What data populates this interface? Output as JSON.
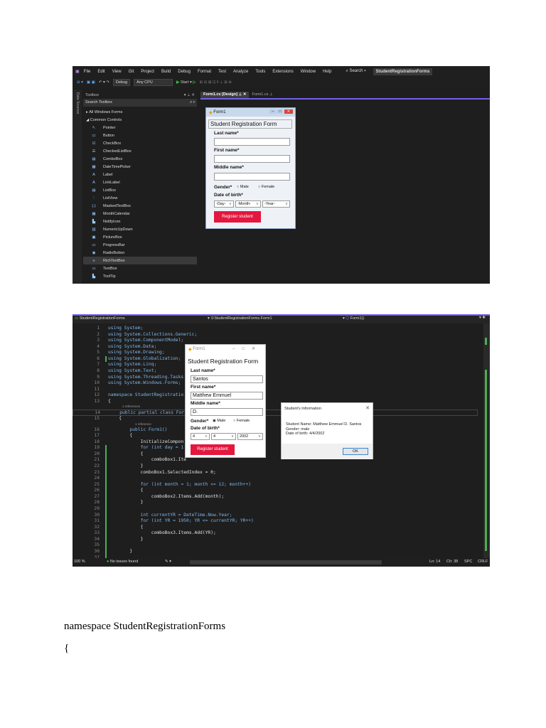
{
  "ide1": {
    "menu": [
      "File",
      "Edit",
      "View",
      "Git",
      "Project",
      "Build",
      "Debug",
      "Format",
      "Test",
      "Analyze",
      "Tools",
      "Extensions",
      "Window",
      "Help"
    ],
    "search": "Search",
    "solution": "StudentRegistrationForms",
    "config": "Debug",
    "platform": "Any CPU",
    "start": "Start",
    "side_strip": "Data Sources",
    "toolbox_title": "Toolbox",
    "toolbox_search": "Search Toolbox",
    "groups": [
      "All Windows Forms",
      "Common Controls"
    ],
    "items": [
      {
        "icon": "pointer-icon",
        "g": "↖",
        "label": "Pointer"
      },
      {
        "icon": "button-icon",
        "g": "▭",
        "label": "Button"
      },
      {
        "icon": "checkbox-icon",
        "g": "☑",
        "label": "CheckBox"
      },
      {
        "icon": "checkedlistbox-icon",
        "g": "☰",
        "label": "CheckedListBox"
      },
      {
        "icon": "combobox-icon",
        "g": "▤",
        "label": "ComboBox"
      },
      {
        "icon": "datetimepicker-icon",
        "g": "▦",
        "label": "DateTimePicker"
      },
      {
        "icon": "label-icon",
        "g": "A",
        "label": "Label"
      },
      {
        "icon": "linklabel-icon",
        "g": "A",
        "label": "LinkLabel"
      },
      {
        "icon": "listbox-icon",
        "g": "▤",
        "label": "ListBox"
      },
      {
        "icon": "listview-icon",
        "g": "⋮",
        "label": "ListView"
      },
      {
        "icon": "maskedtextbox-icon",
        "g": "(.)",
        "label": "MaskedTextBox"
      },
      {
        "icon": "monthcalendar-icon",
        "g": "▦",
        "label": "MonthCalendar"
      },
      {
        "icon": "notifyicon-icon",
        "g": "▙",
        "label": "NotifyIcon"
      },
      {
        "icon": "numericupdown-icon",
        "g": "▥",
        "label": "NumericUpDown"
      },
      {
        "icon": "picturebox-icon",
        "g": "▣",
        "label": "PictureBox"
      },
      {
        "icon": "progressbar-icon",
        "g": "▭",
        "label": "ProgressBar"
      },
      {
        "icon": "radiobutton-icon",
        "g": "◉",
        "label": "RadioButton"
      },
      {
        "icon": "richtextbox-icon",
        "g": "≡",
        "label": "RichTextBox"
      },
      {
        "icon": "textbox-icon",
        "g": "▭",
        "label": "TextBox"
      },
      {
        "icon": "tooltip-icon",
        "g": "▙",
        "label": "ToolTip"
      }
    ],
    "tabs": [
      "Form1.cs [Design]",
      "Form1.cs"
    ],
    "form": {
      "title": "Form1",
      "heading": "Student Registration Form",
      "last": "Last name*",
      "first": "First name*",
      "middle": "Middle name*",
      "gender": "Gender*",
      "male": "Male",
      "female": "Female",
      "dob": "Date of birth*",
      "day": "-Day-",
      "month": "-Month-",
      "year": "-Year-",
      "button": "Register student"
    }
  },
  "ide2": {
    "nav": [
      "StudentRegistrationForms",
      "StudentRegistrationForms.Form1",
      "Form1()"
    ],
    "lens": {
      "refs": "1 references",
      "ref": "1 reference"
    },
    "code": [
      [
        "1",
        "using System;"
      ],
      [
        "2",
        "using System.Collections.Generic;"
      ],
      [
        "3",
        "using System.ComponentModel;"
      ],
      [
        "4",
        "using System.Data;"
      ],
      [
        "5",
        "using System.Drawing;"
      ],
      [
        "6",
        "using System.Globalization;"
      ],
      [
        "7",
        "using System.Linq;"
      ],
      [
        "8",
        "using System.Text;"
      ],
      [
        "9",
        "using System.Threading.Tasks"
      ],
      [
        "10",
        "using System.Windows.Forms;"
      ],
      [
        "11",
        ""
      ],
      [
        "12",
        "namespace StudentRegistratio"
      ],
      [
        "13",
        "{"
      ],
      [
        "14",
        "    public partial class For"
      ],
      [
        "15",
        "    {"
      ],
      [
        "16",
        "        public Form1()"
      ],
      [
        "17",
        "        {"
      ],
      [
        "18",
        "            InitializeCompon"
      ],
      [
        "19",
        "            for (int day = 1"
      ],
      [
        "20",
        "            {"
      ],
      [
        "21",
        "                comboBox1.Ite"
      ],
      [
        "22",
        "            }"
      ],
      [
        "23",
        "            comboBox1.SelectedIndex = 0;"
      ],
      [
        "24",
        ""
      ],
      [
        "25",
        "            for (int month = 1; month <= 12; month++)"
      ],
      [
        "26",
        "            {"
      ],
      [
        "27",
        "                comboBox2.Items.Add(month);"
      ],
      [
        "28",
        "            }"
      ],
      [
        "29",
        ""
      ],
      [
        "30",
        "            int currentYR = DateTime.Now.Year;"
      ],
      [
        "31",
        "            for (int YR = 1950; YR <= currentYR; YR++)"
      ],
      [
        "32",
        "            {"
      ],
      [
        "33",
        "                comboBox3.Items.Add(YR);"
      ],
      [
        "34",
        "            }"
      ],
      [
        "35",
        ""
      ],
      [
        "36",
        "        }"
      ],
      [
        "37",
        ""
      ]
    ],
    "form": {
      "title": "Form1",
      "heading": "Student Registration Form",
      "last": "Last name*",
      "last_val": "Santos",
      "first": "First name*",
      "first_val": "Matthew Emmuel",
      "middle": "Middle name*",
      "middle_val": "D.",
      "gender": "Gender*",
      "male": "Male",
      "female": "Female",
      "dob": "Date of birth*",
      "day": "4",
      "month": "4",
      "year": "2002",
      "button": "Register student"
    },
    "dialog": {
      "title": "Student's Information",
      "line1": "Student Name: Matthew Emmuel D. Santos",
      "line2": "Gender: male",
      "line3": "Date of birth: 4/4/2002",
      "ok": "OK"
    },
    "status": {
      "zoom": "100 %",
      "issues": "No issues found",
      "ln": "Ln: 14",
      "ch": "Ch: 38",
      "enc": "SPC",
      "eol": "CRLF"
    }
  },
  "doc": {
    "line1": "namespace StudentRegistrationForms",
    "line2": "{"
  }
}
